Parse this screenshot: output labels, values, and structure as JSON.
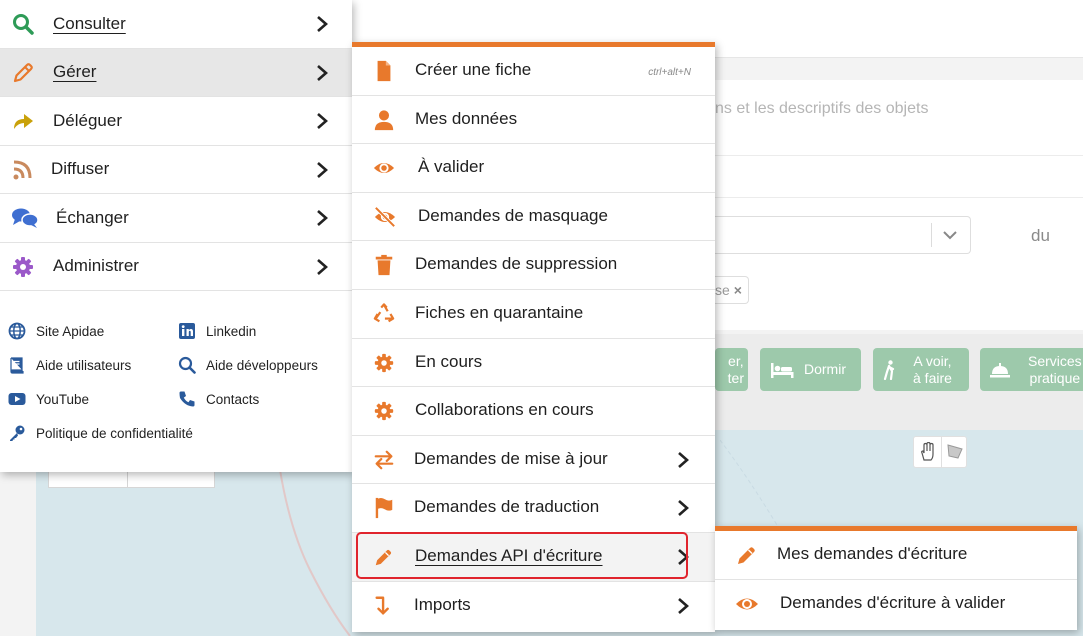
{
  "colors": {
    "accent": "#e8792c",
    "highlight_box": "#e0242d",
    "category_green": "#9dc9ab"
  },
  "background": {
    "search_placeholder": "ns et les descriptifs des objets",
    "du_label": "du",
    "tag_text": "se",
    "tag_remove": "×",
    "categories": [
      {
        "line1": "er,",
        "line2": "ter",
        "icon": "unknown-icon"
      },
      {
        "line1": "Dormir",
        "line2": "",
        "icon": "bed-icon"
      },
      {
        "line1": "A voir,",
        "line2": "à faire",
        "icon": "walking-icon"
      },
      {
        "line1": "Services",
        "line2": "pratique",
        "icon": "service-bell-icon"
      }
    ]
  },
  "main_menu": {
    "items": [
      {
        "label": "Consulter",
        "icon": "search-icon",
        "color": "#2e9b57"
      },
      {
        "label": "Gérer",
        "icon": "pencil-icon",
        "color": "#e8792c"
      },
      {
        "label": "Déléguer",
        "icon": "share-arrow-icon",
        "color": "#c9a10a"
      },
      {
        "label": "Diffuser",
        "icon": "rss-icon",
        "color": "#c98a5e"
      },
      {
        "label": "Échanger",
        "icon": "chat-bubbles-icon",
        "color": "#3f6fd1"
      },
      {
        "label": "Administrer",
        "icon": "gear-icon",
        "color": "#9b59c9"
      }
    ],
    "links": [
      {
        "label": "Site Apidae",
        "icon": "globe-icon"
      },
      {
        "label": "Linkedin",
        "icon": "linkedin-icon"
      },
      {
        "label": "Aide utilisateurs",
        "icon": "book-icon"
      },
      {
        "label": "Aide développeurs",
        "icon": "search-icon"
      },
      {
        "label": "YouTube",
        "icon": "youtube-icon"
      },
      {
        "label": "Contacts",
        "icon": "phone-icon"
      },
      {
        "label": "Politique de confidentialité",
        "icon": "key-icon"
      }
    ]
  },
  "sub_menu": {
    "items": [
      {
        "label": "Créer une fiche",
        "icon": "file-icon",
        "shortcut": "ctrl+alt+N"
      },
      {
        "label": "Mes données",
        "icon": "user-icon"
      },
      {
        "label": "À valider",
        "icon": "eye-icon"
      },
      {
        "label": "Demandes de masquage",
        "icon": "eye-slash-icon"
      },
      {
        "label": "Demandes de suppression",
        "icon": "trash-icon"
      },
      {
        "label": "Fiches en quarantaine",
        "icon": "recycle-icon"
      },
      {
        "label": "En cours",
        "icon": "gear-icon"
      },
      {
        "label": "Collaborations en cours",
        "icon": "gear-icon"
      },
      {
        "label": "Demandes de mise à jour",
        "icon": "exchange-arrows-icon"
      },
      {
        "label": "Demandes de traduction",
        "icon": "flag-icon"
      },
      {
        "label": "Demandes API d'écriture",
        "icon": "pencil-icon"
      },
      {
        "label": "Imports",
        "icon": "level-down-icon"
      }
    ]
  },
  "sub2_menu": {
    "items": [
      {
        "label": "Mes demandes d'écriture",
        "icon": "pencil-icon"
      },
      {
        "label": "Demandes d'écriture à valider",
        "icon": "eye-icon"
      }
    ]
  }
}
